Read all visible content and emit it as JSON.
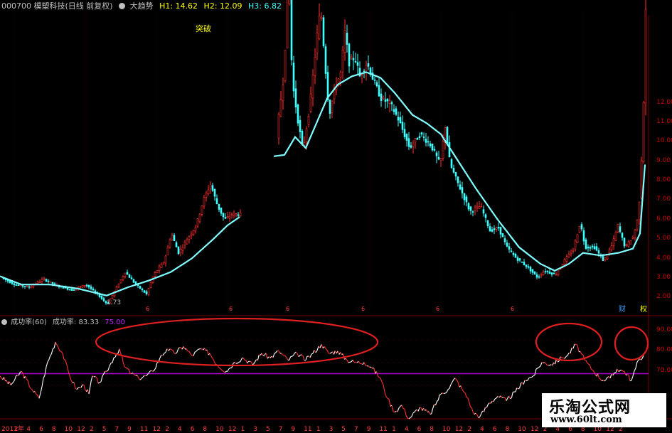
{
  "header": {
    "stock": "000700 模塑科技(日线 前复权)",
    "indicator_name": "大趋势",
    "h1": "H1: 14.62",
    "h2": "H2: 12.09",
    "h3": "H3: 6.82",
    "annotation": "突破"
  },
  "sub_header": {
    "indicator": "成功率(60)",
    "value_label": "成功率: 83.33",
    "level": "75.00"
  },
  "watermark": {
    "cn": "乐淘公式网",
    "url": "www.60lt.com"
  },
  "colors": {
    "up": "#ff3030",
    "down": "#40ffff",
    "ma": "#7fffff",
    "grid": "#7a0000",
    "ellipse": "#e02020",
    "level": "#b000d0",
    "line": "#ffffff",
    "axis_text": "#c80000",
    "header_white": "#c0c0c0",
    "header_yellow": "#ffff00",
    "header_cyan": "#40ffff",
    "annotation": "#ffff00",
    "level_label": "#c020ff"
  },
  "chart_data": [
    {
      "type": "candlestick",
      "title": "000700 模塑科技(日线 前复权)",
      "ylim": [
        1.5,
        12.2
      ],
      "y_ticks": [
        "2.00",
        "3.00",
        "4.00",
        "5.00",
        "6.00",
        "7.00",
        "8.00",
        "9.00",
        "10.00",
        "11.00",
        "12.00"
      ],
      "low_marker": "1.73",
      "badges": [
        "财",
        "权"
      ],
      "ma_series": [
        [
          0,
          2.75
        ],
        [
          30,
          2.45
        ],
        [
          70,
          2.45
        ],
        [
          110,
          2.3
        ],
        [
          150,
          2.05
        ],
        [
          180,
          2.35
        ],
        [
          210,
          2.6
        ],
        [
          240,
          2.9
        ],
        [
          270,
          3.4
        ],
        [
          300,
          4.1
        ],
        [
          320,
          4.6
        ],
        [
          337,
          4.9
        ],
        [
          385,
          7.1
        ],
        [
          400,
          7.15
        ],
        [
          415,
          7.8
        ],
        [
          430,
          7.4
        ],
        [
          445,
          8.3
        ],
        [
          460,
          9.2
        ],
        [
          475,
          9.7
        ],
        [
          495,
          10.0
        ],
        [
          515,
          10.15
        ],
        [
          535,
          9.95
        ],
        [
          555,
          9.4
        ],
        [
          580,
          8.6
        ],
        [
          600,
          8.3
        ],
        [
          620,
          7.9
        ],
        [
          645,
          6.9
        ],
        [
          670,
          5.9
        ],
        [
          700,
          4.8
        ],
        [
          730,
          3.8
        ],
        [
          760,
          3.2
        ],
        [
          780,
          2.95
        ],
        [
          800,
          3.2
        ],
        [
          820,
          3.6
        ],
        [
          845,
          3.5
        ],
        [
          870,
          3.6
        ],
        [
          890,
          3.75
        ],
        [
          900,
          4.3
        ],
        [
          907,
          6.8
        ]
      ],
      "price_path": [
        [
          0,
          2.7
        ],
        [
          20,
          2.45
        ],
        [
          40,
          2.35
        ],
        [
          60,
          2.65
        ],
        [
          80,
          2.4
        ],
        [
          100,
          2.25
        ],
        [
          120,
          2.45
        ],
        [
          140,
          2.0
        ],
        [
          150,
          1.73
        ],
        [
          160,
          2.2
        ],
        [
          175,
          2.9
        ],
        [
          190,
          2.45
        ],
        [
          205,
          2.1
        ],
        [
          215,
          2.8
        ],
        [
          230,
          3.3
        ],
        [
          240,
          4.3
        ],
        [
          250,
          3.6
        ],
        [
          265,
          4.2
        ],
        [
          275,
          4.6
        ],
        [
          285,
          5.5
        ],
        [
          295,
          6.1
        ],
        [
          305,
          5.3
        ],
        [
          315,
          4.8
        ],
        [
          325,
          5.0
        ],
        [
          337,
          5.0
        ],
        [
          385,
          7.1
        ],
        [
          393,
          9.0
        ],
        [
          398,
          10.0
        ],
        [
          405,
          13.8
        ],
        [
          410,
          9.8
        ],
        [
          418,
          8.4
        ],
        [
          425,
          7.3
        ],
        [
          435,
          9.0
        ],
        [
          445,
          11.5
        ],
        [
          450,
          12.5
        ],
        [
          456,
          10.5
        ],
        [
          462,
          8.6
        ],
        [
          470,
          9.6
        ],
        [
          478,
          10.1
        ],
        [
          484,
          11.6
        ],
        [
          490,
          10.5
        ],
        [
          498,
          10.7
        ],
        [
          505,
          10.0
        ],
        [
          515,
          10.5
        ],
        [
          525,
          9.8
        ],
        [
          535,
          9.2
        ],
        [
          548,
          9.0
        ],
        [
          560,
          8.4
        ],
        [
          575,
          7.4
        ],
        [
          590,
          7.9
        ],
        [
          605,
          7.5
        ],
        [
          618,
          6.8
        ],
        [
          625,
          8.2
        ],
        [
          632,
          6.8
        ],
        [
          645,
          6.0
        ],
        [
          660,
          5.1
        ],
        [
          675,
          5.3
        ],
        [
          688,
          4.4
        ],
        [
          700,
          4.5
        ],
        [
          712,
          3.8
        ],
        [
          725,
          3.4
        ],
        [
          740,
          3.1
        ],
        [
          755,
          2.7
        ],
        [
          765,
          2.95
        ],
        [
          780,
          2.8
        ],
        [
          795,
          3.4
        ],
        [
          805,
          3.7
        ],
        [
          815,
          4.7
        ],
        [
          822,
          3.8
        ],
        [
          835,
          3.8
        ],
        [
          848,
          3.3
        ],
        [
          860,
          3.9
        ],
        [
          868,
          4.6
        ],
        [
          878,
          3.8
        ],
        [
          890,
          4.2
        ],
        [
          897,
          5.0
        ],
        [
          903,
          8.0
        ],
        [
          907,
          12.5
        ]
      ]
    },
    {
      "type": "line",
      "title": "成功率(60)",
      "ylim": [
        55,
        95
      ],
      "y_ticks": [
        "70.00",
        "80.00",
        "90.00"
      ],
      "level": 75,
      "last_value": 83.33,
      "x_ticks": [
        "2011年",
        "2",
        "4",
        "6",
        "8",
        "10",
        "12",
        "2",
        "5",
        "7",
        "9",
        "11",
        "12",
        "2",
        "4",
        "6",
        "8",
        "10",
        "12",
        "1",
        "3",
        "5",
        "7",
        "9",
        "11",
        "1",
        "3",
        "5",
        "7",
        "9",
        "11",
        "1",
        "4",
        "6",
        "8",
        "10",
        "12",
        "2",
        "4",
        "6",
        "8",
        "10",
        "12",
        "2",
        "4",
        "6",
        "8",
        "10",
        "12",
        "2"
      ],
      "x_tick_color": "#ff4040",
      "series": [
        [
          0,
          74
        ],
        [
          15,
          70
        ],
        [
          30,
          76
        ],
        [
          45,
          68
        ],
        [
          55,
          64
        ],
        [
          65,
          78
        ],
        [
          78,
          89
        ],
        [
          88,
          84
        ],
        [
          98,
          74
        ],
        [
          108,
          68
        ],
        [
          118,
          70
        ],
        [
          125,
          66
        ],
        [
          130,
          74
        ],
        [
          140,
          71
        ],
        [
          150,
          76
        ],
        [
          160,
          82
        ],
        [
          168,
          86
        ],
        [
          175,
          78
        ],
        [
          185,
          75
        ],
        [
          195,
          73
        ],
        [
          205,
          74
        ],
        [
          215,
          76
        ],
        [
          225,
          82
        ],
        [
          235,
          86
        ],
        [
          245,
          84
        ],
        [
          258,
          87
        ],
        [
          270,
          83
        ],
        [
          282,
          86
        ],
        [
          295,
          84
        ],
        [
          305,
          79
        ],
        [
          318,
          76
        ],
        [
          330,
          80
        ],
        [
          342,
          82
        ],
        [
          355,
          79
        ],
        [
          368,
          84
        ],
        [
          380,
          82
        ],
        [
          392,
          85
        ],
        [
          405,
          81
        ],
        [
          418,
          84
        ],
        [
          430,
          81
        ],
        [
          440,
          84
        ],
        [
          452,
          88
        ],
        [
          462,
          84
        ],
        [
          475,
          85
        ],
        [
          488,
          81
        ],
        [
          500,
          80
        ],
        [
          512,
          80
        ],
        [
          522,
          78
        ],
        [
          535,
          73
        ],
        [
          545,
          64
        ],
        [
          555,
          58
        ],
        [
          565,
          61
        ],
        [
          575,
          55
        ],
        [
          590,
          60
        ],
        [
          605,
          57
        ],
        [
          620,
          66
        ],
        [
          630,
          68
        ],
        [
          640,
          73
        ],
        [
          650,
          68
        ],
        [
          658,
          64
        ],
        [
          665,
          58
        ],
        [
          675,
          56
        ],
        [
          688,
          62
        ],
        [
          700,
          65
        ],
        [
          712,
          63
        ],
        [
          725,
          67
        ],
        [
          738,
          72
        ],
        [
          750,
          74
        ],
        [
          762,
          80
        ],
        [
          775,
          79
        ],
        [
          790,
          82
        ],
        [
          798,
          83
        ],
        [
          810,
          88
        ],
        [
          822,
          81
        ],
        [
          835,
          76
        ],
        [
          848,
          72
        ],
        [
          858,
          73
        ],
        [
          868,
          77
        ],
        [
          878,
          76
        ],
        [
          888,
          72
        ],
        [
          898,
          81
        ],
        [
          905,
          83
        ]
      ]
    }
  ]
}
